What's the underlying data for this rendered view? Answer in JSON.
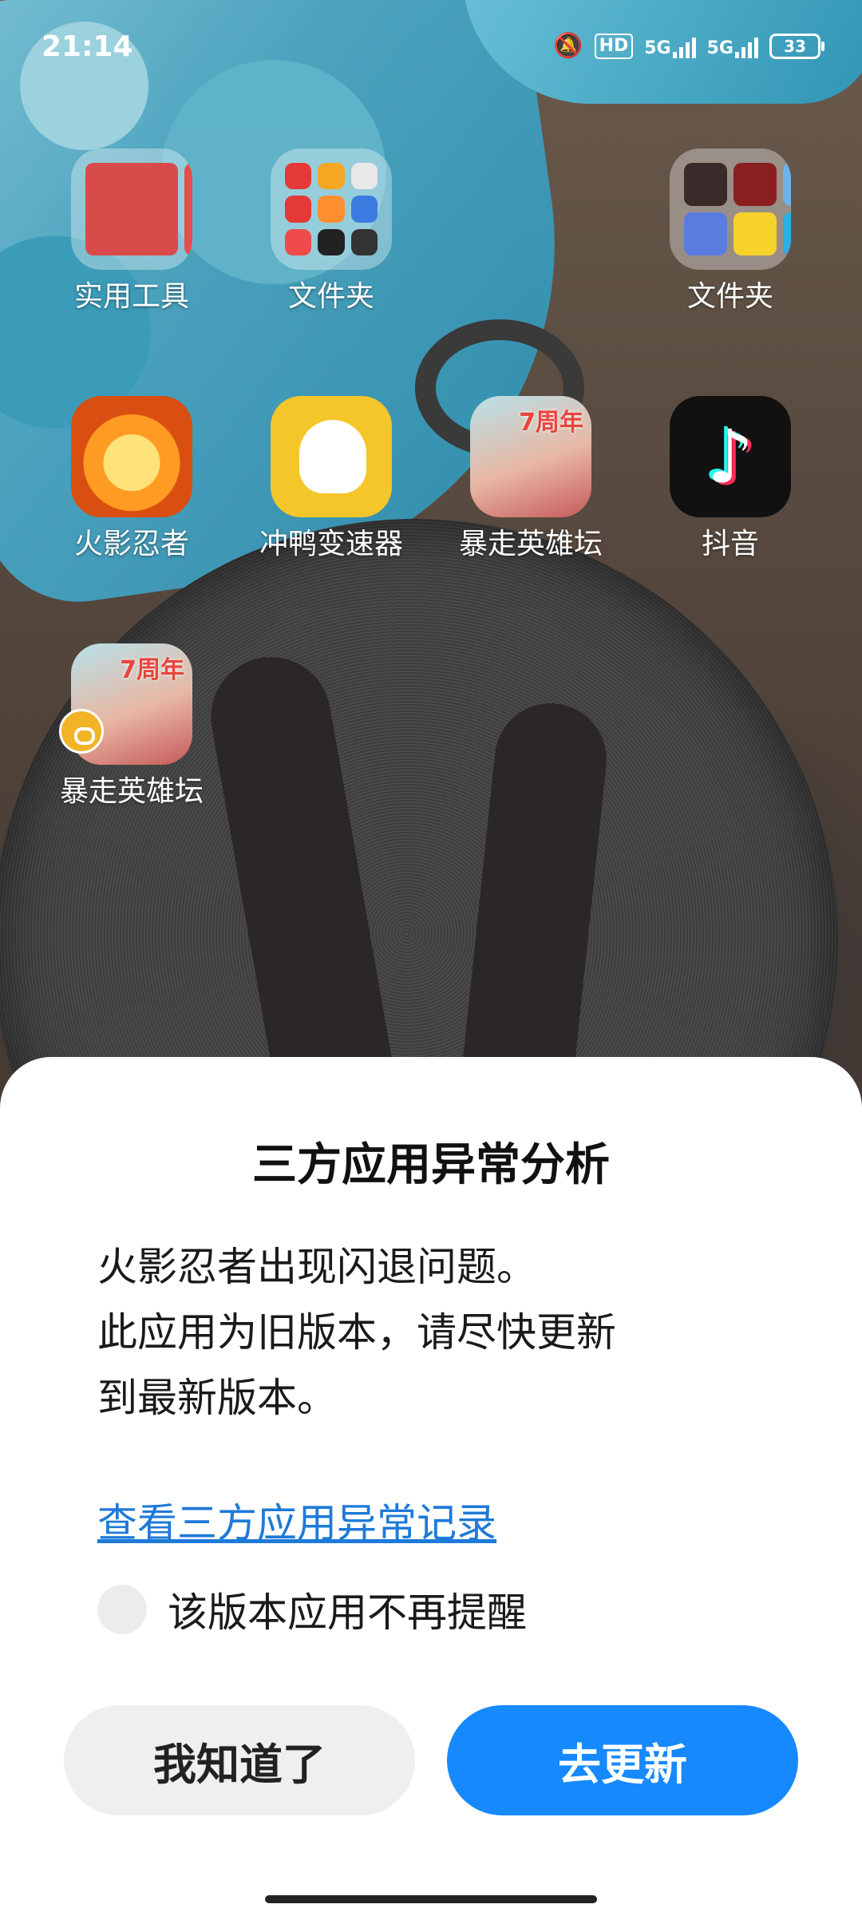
{
  "status_bar": {
    "time": "21:14",
    "icons": [
      "mute-bell-icon",
      "hd-icon",
      "signal-5g-icon",
      "signal-5g-icon",
      "battery-icon"
    ],
    "hd_label": "HD",
    "network1": "5G",
    "network2": "5G",
    "battery": "33"
  },
  "home": {
    "apps": [
      {
        "label": "实用工具",
        "type": "folder"
      },
      {
        "label": "文件夹",
        "type": "folder"
      },
      {
        "label": "文件夹",
        "type": "folder"
      },
      {
        "label": "火影忍者",
        "type": "app"
      },
      {
        "label": "冲鸭变速器",
        "type": "app"
      },
      {
        "label": "暴走英雄坛",
        "type": "app"
      },
      {
        "label": "抖音",
        "type": "app"
      },
      {
        "label": "暴走英雄坛",
        "type": "app",
        "locked": true
      }
    ]
  },
  "dialog": {
    "title": "三方应用异常分析",
    "message_lines": [
      "火影忍者出现闪退问题。",
      "此应用为旧版本，请尽快更新",
      "到最新版本。"
    ],
    "link_text": "查看三方应用异常记录",
    "checkbox_label": "该版本应用不再提醒",
    "checkbox_checked": false,
    "dismiss_button": "我知道了",
    "update_button": "去更新"
  },
  "colors": {
    "accent": "#1689fe",
    "link": "#1e7ad8"
  }
}
